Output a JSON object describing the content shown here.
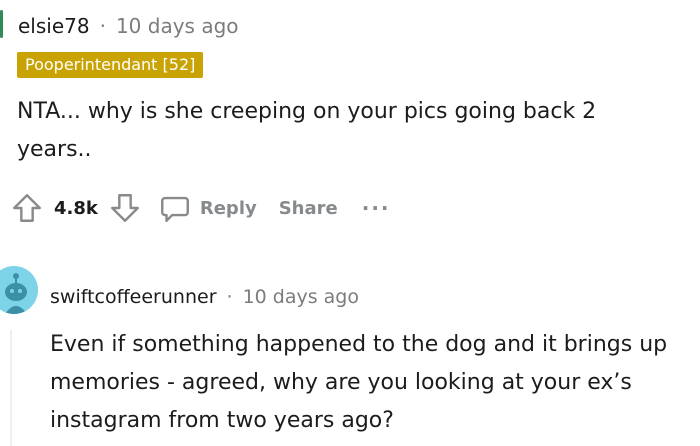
{
  "comment": {
    "username": "elsie78",
    "separator": "·",
    "time": "10 days ago",
    "flair": "Pooperintendant [52]",
    "body": "NTA... why is she creeping on your pics going back 2 years..",
    "votes": "4.8k",
    "actions": {
      "reply": "Reply",
      "share": "Share",
      "more": "..."
    }
  },
  "reply": {
    "username": "swiftcoffeerunner",
    "separator": "·",
    "time": "10 days ago",
    "body": "Even if something happened to the dog and it brings up memories - agreed, why are you looking at your ex’s instagram from two years ago?"
  },
  "colors": {
    "flair_bg": "#c9a303",
    "avatar_bg": "#7dd3e8",
    "muted": "#7c7c7c",
    "action_gray": "#878a8c"
  },
  "icons": {
    "upvote": "arrow-up-icon",
    "downvote": "arrow-down-icon",
    "reply": "speech-bubble-icon",
    "avatar": "snoo-avatar-icon"
  }
}
